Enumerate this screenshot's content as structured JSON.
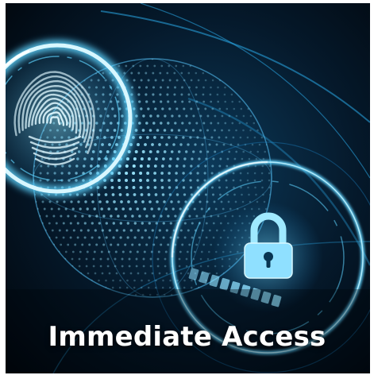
{
  "image": {
    "caption": "Immediate Access",
    "icons": [
      "fingerprint-icon",
      "padlock-icon",
      "globe-dots"
    ],
    "colors": {
      "background": "#020a12",
      "glow": "#5fd4ff",
      "glow_deep": "#1f8fd6",
      "caption_text": "#ffffff"
    }
  }
}
